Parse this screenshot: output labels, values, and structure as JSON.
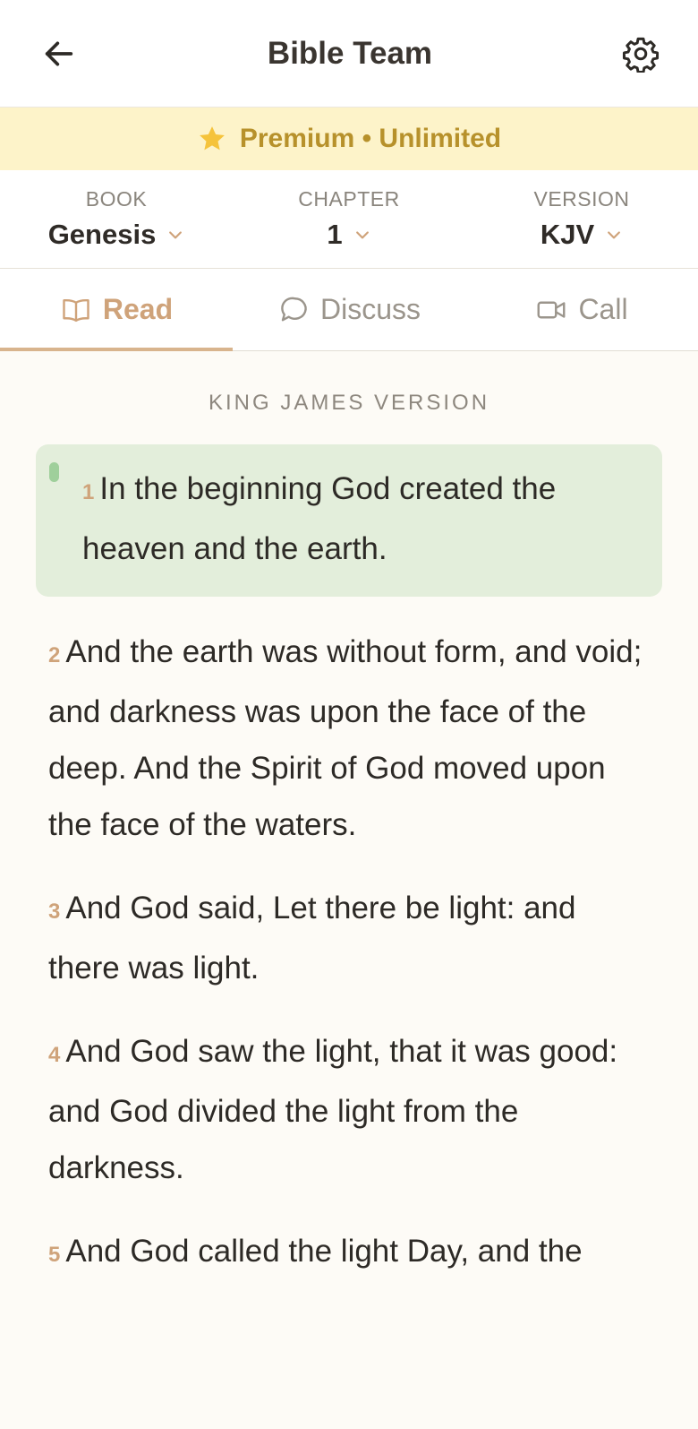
{
  "header": {
    "title": "Bible Team",
    "back_icon": "arrow-left-icon",
    "settings_icon": "gear-icon"
  },
  "premium": {
    "label": "Premium • Unlimited",
    "star_color": "#f5c33b",
    "text_color": "#b7912b"
  },
  "selectors": {
    "book": {
      "label": "BOOK",
      "value": "Genesis"
    },
    "chapter": {
      "label": "CHAPTER",
      "value": "1"
    },
    "version": {
      "label": "VERSION",
      "value": "KJV"
    }
  },
  "tabs": [
    {
      "label": "Read",
      "icon": "book-icon",
      "active": true
    },
    {
      "label": "Discuss",
      "icon": "chat-bubble-icon",
      "active": false
    },
    {
      "label": "Call",
      "icon": "video-camera-icon",
      "active": false
    }
  ],
  "version_heading": "KING JAMES VERSION",
  "verses": [
    {
      "num": "1",
      "text": "In the beginning God created the heaven and the earth.",
      "highlighted": true
    },
    {
      "num": "2",
      "text": "And the earth was without form, and void; and darkness was upon the face of the deep. And the Spirit of God moved upon the face of the waters."
    },
    {
      "num": "3",
      "text": "And God said, Let there be light: and there was light."
    },
    {
      "num": "4",
      "text": "And God saw the light, that it was good: and God divided the light from the darkness."
    },
    {
      "num": "5",
      "text": "And God called the light Day, and the"
    }
  ],
  "colors": {
    "accent": "#cfa37a",
    "highlight_bg": "#e3eedb",
    "premium_bg": "#fdf3c9",
    "page_bg": "#fdfbf6"
  }
}
